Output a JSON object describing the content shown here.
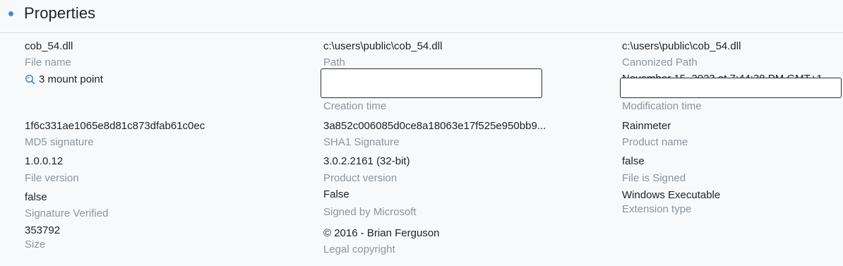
{
  "section": {
    "title": "Properties"
  },
  "file_name": {
    "value": "cob_54.dll",
    "label": "File name"
  },
  "mount_point": {
    "value": "3 mount point",
    "icon": "search-icon"
  },
  "path": {
    "value": "c:\\users\\public\\cob_54.dll",
    "label": "Path"
  },
  "canonized_path": {
    "value": "c:\\users\\public\\cob_54.dll",
    "label": "Canonized Path"
  },
  "creation_time": {
    "label": "Creation time"
  },
  "modification_time": {
    "value": "November 15, 2023 at 7:44:38 PM GMT+1",
    "label": "Modification time"
  },
  "md5": {
    "value": "1f6c331ae1065e8d81c873dfab61c0ec",
    "label": "MD5 signature"
  },
  "sha1": {
    "value": "3a852c006085d0ce8a18063e17f525e950bb9...",
    "label": "SHA1 Signature"
  },
  "product_name": {
    "value": "Rainmeter",
    "label": "Product name"
  },
  "file_version": {
    "value": "1.0.0.12",
    "label": "File version"
  },
  "product_version": {
    "value": "3.0.2.2161 (32-bit)",
    "label": "Product version"
  },
  "file_is_signed": {
    "value": "false",
    "label": "File is Signed"
  },
  "signature_verified": {
    "value": "false",
    "label": "Signature Verified"
  },
  "signed_by_microsoft": {
    "value": "False",
    "label": "Signed by Microsoft"
  },
  "extension_type": {
    "value": "Windows Executable",
    "label": "Extension type"
  },
  "size": {
    "value": "353792",
    "label": "Size"
  },
  "legal_copyright": {
    "value": "© 2016 - Brian Ferguson",
    "label": "Legal copyright"
  },
  "colors": {
    "accent": "#3f8fd6",
    "value_text": "#202326",
    "label_text": "#8c959c",
    "background": "#f8f9fa"
  }
}
